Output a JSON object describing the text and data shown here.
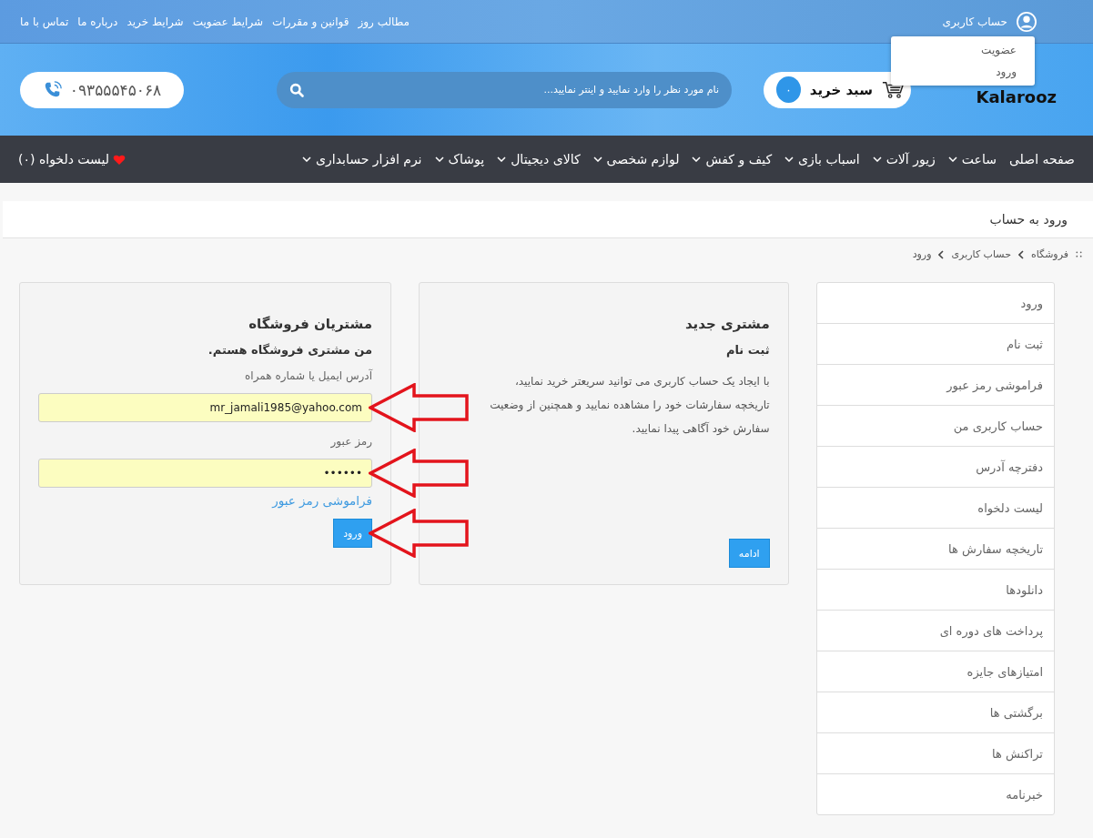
{
  "topbar": {
    "links": [
      "مطالب روز",
      "قوانین و مقررات",
      "شرایط عضویت",
      "شرایط خرید",
      "درباره ما",
      "تماس با ما"
    ],
    "account": "حساب کاربری"
  },
  "account_menu": [
    "عضویت",
    "ورود"
  ],
  "header": {
    "logo": "Kalarooz",
    "cart_label": "سبد خرید",
    "cart_count": "۰",
    "search": {
      "placeholder": "نام مورد نظر را وارد نمایید و اینتر نمایید..."
    },
    "phone": "۰۹۳۵۵۵۴۵۰۶۸"
  },
  "nav": {
    "items": [
      {
        "label": "صفحه اصلی",
        "dropdown": false
      },
      {
        "label": "ساعت",
        "dropdown": true
      },
      {
        "label": "زیور آلات",
        "dropdown": true
      },
      {
        "label": "اسباب بازی",
        "dropdown": true
      },
      {
        "label": "کیف و کفش",
        "dropdown": true
      },
      {
        "label": "لوازم شخصی",
        "dropdown": true
      },
      {
        "label": "کالای دیجیتال",
        "dropdown": true
      },
      {
        "label": "پوشاک",
        "dropdown": true
      },
      {
        "label": "نرم افزار حسابداری",
        "dropdown": true
      }
    ],
    "wishlist": "لیست دلخواه (۰)"
  },
  "page_title": "ورود به حساب",
  "breadcrumb": [
    "فروشگاه",
    "حساب کاربری",
    "ورود"
  ],
  "sidebar": {
    "items": [
      "ورود",
      "ثبت نام",
      "فراموشی رمز عبور",
      "حساب کاربری من",
      "دفترچه آدرس",
      "لیست دلخواه",
      "تاریخچه سفارش ها",
      "دانلودها",
      "پرداخت های دوره ای",
      "امتیازهای جایزه",
      "برگشتی ها",
      "تراکنش ها",
      "خبرنامه"
    ]
  },
  "new_customer": {
    "title": "مشتری جدید",
    "subtitle": "ثبت نام",
    "text": "با ایجاد یک حساب کاربری می توانید سریعتر خرید نمایید، تاریخچه سفارشات خود را مشاهده نمایید و همچنین از وضعیت سفارش خود آگاهی پیدا نمایید.",
    "button": "ادامه"
  },
  "returning_customer": {
    "title": "مشتریان فروشگاه",
    "subtitle": "من مشتری فروشگاه هستم.",
    "email_label": "آدرس ایمیل یا شماره همراه",
    "email_value": "mr_jamali1985@yahoo.com",
    "password_label": "رمز عبور",
    "password_value": "••••••",
    "forgot_link": "فراموشی رمز عبور",
    "button": "ورود"
  }
}
